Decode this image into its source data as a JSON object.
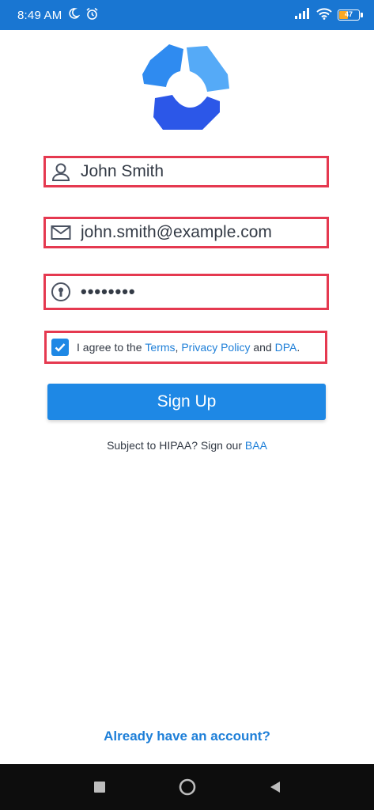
{
  "status_bar": {
    "time": "8:49 AM",
    "battery": "47",
    "icons": [
      "moon-icon",
      "alarm-icon",
      "signal-icon",
      "wifi-icon",
      "battery-icon"
    ]
  },
  "form": {
    "name_value": "John Smith",
    "email_value": "john.smith@example.com",
    "password_value": "••••••••",
    "agree_prefix": "I agree to the ",
    "terms_label": "Terms",
    "comma": ", ",
    "privacy_label": "Privacy Policy",
    "and_text": " and ",
    "dpa_label": "DPA",
    "period": ".",
    "agree_checked": true
  },
  "signup_button_label": "Sign Up",
  "hipaa": {
    "prefix": "Subject to HIPAA? Sign our ",
    "link_label": "BAA"
  },
  "login_link_label": "Already have an account?",
  "colors": {
    "primary": "#1e88e5",
    "status_bar": "#1976d2",
    "highlight_border": "#e53950",
    "link": "#1e7fd8"
  }
}
